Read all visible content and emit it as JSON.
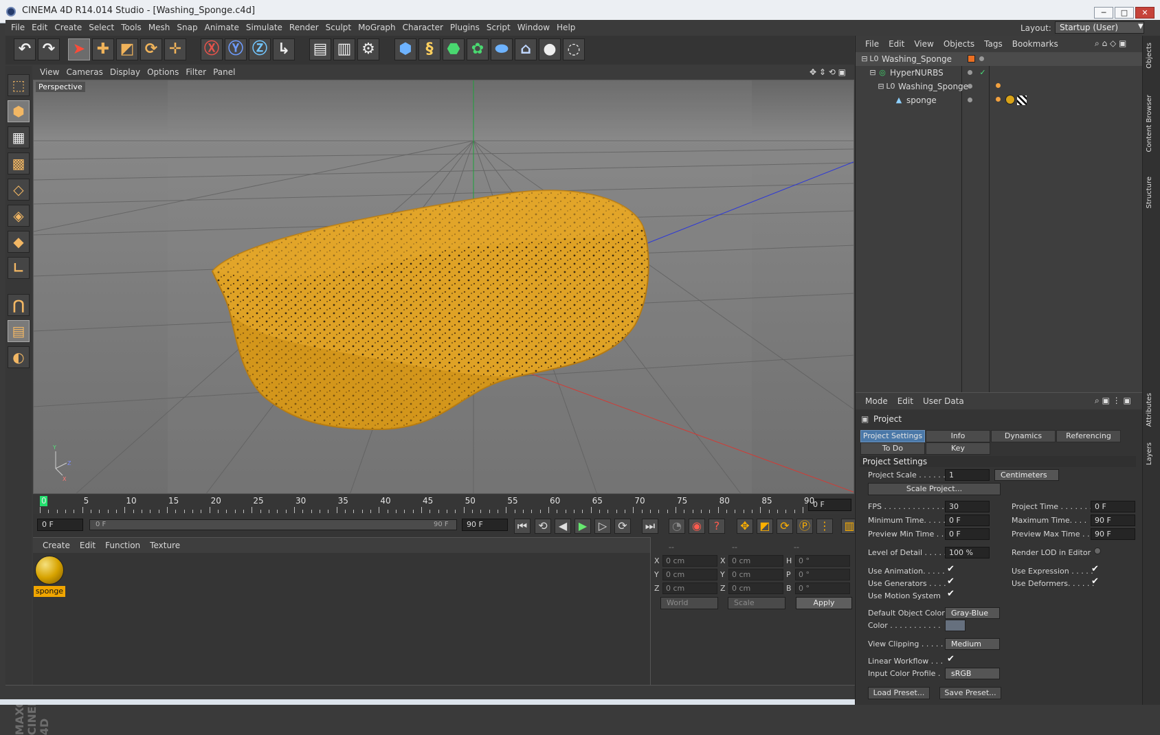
{
  "window": {
    "title": "CINEMA 4D R14.014 Studio - [Washing_Sponge.c4d]",
    "buttons": [
      "─",
      "□",
      "✕"
    ]
  },
  "menu": [
    "File",
    "Edit",
    "Create",
    "Select",
    "Tools",
    "Mesh",
    "Snap",
    "Animate",
    "Simulate",
    "Render",
    "Sculpt",
    "MoGraph",
    "Character",
    "Plugins",
    "Script",
    "Window",
    "Help"
  ],
  "layout": {
    "label": "Layout:",
    "value": "Startup (User)"
  },
  "viewport": {
    "menu": [
      "View",
      "Cameras",
      "Display",
      "Options",
      "Filter",
      "Panel"
    ],
    "label": "Perspective"
  },
  "timeline": {
    "ticks": [
      "0",
      "5",
      "10",
      "15",
      "20",
      "25",
      "30",
      "35",
      "40",
      "45",
      "50",
      "55",
      "60",
      "65",
      "70",
      "75",
      "80",
      "85",
      "90"
    ],
    "current_frame": "0 F",
    "start_field": "0 F",
    "range_start": "0 F",
    "range_end": "90 F",
    "end_field": "90 F"
  },
  "material_manager": {
    "menu": [
      "Create",
      "Edit",
      "Function",
      "Texture"
    ],
    "material": "sponge"
  },
  "coordinates": {
    "headers": [
      "--",
      "--",
      "--"
    ],
    "rows": [
      {
        "l1": "X",
        "v1": "0 cm",
        "l2": "X",
        "v2": "0 cm",
        "l3": "H",
        "v3": "0 °"
      },
      {
        "l1": "Y",
        "v1": "0 cm",
        "l2": "Y",
        "v2": "0 cm",
        "l3": "P",
        "v3": "0 °"
      },
      {
        "l1": "Z",
        "v1": "0 cm",
        "l2": "Z",
        "v2": "0 cm",
        "l3": "B",
        "v3": "0 °"
      }
    ],
    "world": "World",
    "scale": "Scale",
    "apply": "Apply"
  },
  "object_manager": {
    "menu": [
      "File",
      "Edit",
      "View",
      "Objects",
      "Tags",
      "Bookmarks"
    ],
    "objects": [
      {
        "name": "Washing_Sponge",
        "icon": "L0"
      },
      {
        "name": "HyperNURBS",
        "icon": "◎"
      },
      {
        "name": "Washing_Sponge",
        "icon": "L0"
      },
      {
        "name": "sponge",
        "icon": "▲"
      }
    ]
  },
  "attribute_manager": {
    "menu": [
      "Mode",
      "Edit",
      "User Data"
    ],
    "title": "Project",
    "tabs": [
      "Project Settings",
      "Info",
      "Dynamics",
      "Referencing"
    ],
    "tabs2": [
      "To Do",
      "Key Interpolation"
    ],
    "section": "Project Settings",
    "project_scale": {
      "label": "Project Scale . . . . . .",
      "value": "1",
      "unit": "Centimeters"
    },
    "scale_project": "Scale Project...",
    "fps": {
      "label": "FPS . . . . . . . . . . . . . .",
      "value": "30"
    },
    "project_time": {
      "label": "Project Time . . . . . . . .",
      "value": "0 F"
    },
    "minimum_time": {
      "label": "Minimum Time. . . . .",
      "value": "0 F"
    },
    "maximum_time": {
      "label": "Maximum Time. . . .",
      "value": "90 F"
    },
    "preview_min": {
      "label": "Preview Min Time . . .",
      "value": "0 F"
    },
    "preview_max": {
      "label": "Preview Max Time . . .",
      "value": "90 F"
    },
    "lod": {
      "label": "Level of Detail . . . . .",
      "value": "100 %"
    },
    "render_lod": {
      "label": "Render LOD in Editor"
    },
    "use_animation": {
      "label": "Use Animation. . . . .",
      "check": "✔"
    },
    "use_expression": {
      "label": "Use Expression . . . . .",
      "check": "✔"
    },
    "use_generators": {
      "label": "Use Generators . . . .",
      "check": "✔"
    },
    "use_deformers": {
      "label": "Use Deformers. . . . . .",
      "check": "✔"
    },
    "use_motion": {
      "label": "Use Motion System",
      "check": "✔"
    },
    "default_color": {
      "label": "Default Object Color",
      "value": "Gray-Blue"
    },
    "color": {
      "label": "Color . . . . . . . . . . ."
    },
    "view_clipping": {
      "label": "View Clipping . . . . .",
      "value": "Medium"
    },
    "linear_workflow": {
      "label": "Linear Workflow . . .",
      "check": "✔"
    },
    "input_color_profile": {
      "label": "Input Color Profile .",
      "value": "sRGB"
    },
    "load_preset": "Load Preset...",
    "save_preset": "Save Preset..."
  },
  "side_tabs": [
    "Objects",
    "Content Browser",
    "Structure",
    "Attributes",
    "Layers"
  ],
  "brand": "MAXON CINEMA 4D"
}
